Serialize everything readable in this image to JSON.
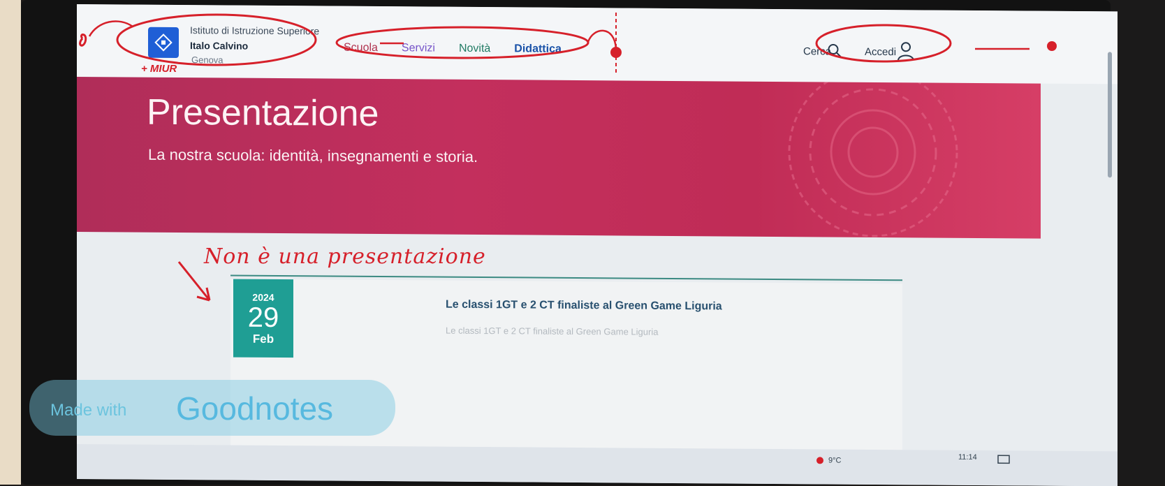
{
  "header": {
    "brand_subtitle": "Istituto di Istruzione Superiore",
    "brand_name": "Italo Calvino",
    "brand_city": "Genova",
    "nav": [
      "Scuola",
      "Servizi",
      "Novità",
      "Didattica"
    ],
    "search_label": "Cerca",
    "login_label": "Accedi"
  },
  "hero": {
    "title": "Presentazione",
    "subtitle": "La nostra scuola: identità, insegnamenti e storia."
  },
  "news": {
    "year": "2024",
    "day": "29",
    "month": "Feb",
    "title": "Le classi 1GT e 2 CT finaliste al Green Game Liguria",
    "description": "Le classi 1GT e 2 CT finaliste al Green Game Liguria"
  },
  "taskbar": {
    "temperature": "9°C",
    "time": "11:14"
  },
  "annotations": {
    "miur_note": "+ MIUR",
    "comment": "Non è una presentazione"
  },
  "watermark": {
    "made_with": "Made with",
    "brand": "Goodnotes"
  },
  "colors": {
    "hero_bg": "#c02c56",
    "date_badge": "#1f9e94",
    "annotation_red": "#d6202a"
  }
}
